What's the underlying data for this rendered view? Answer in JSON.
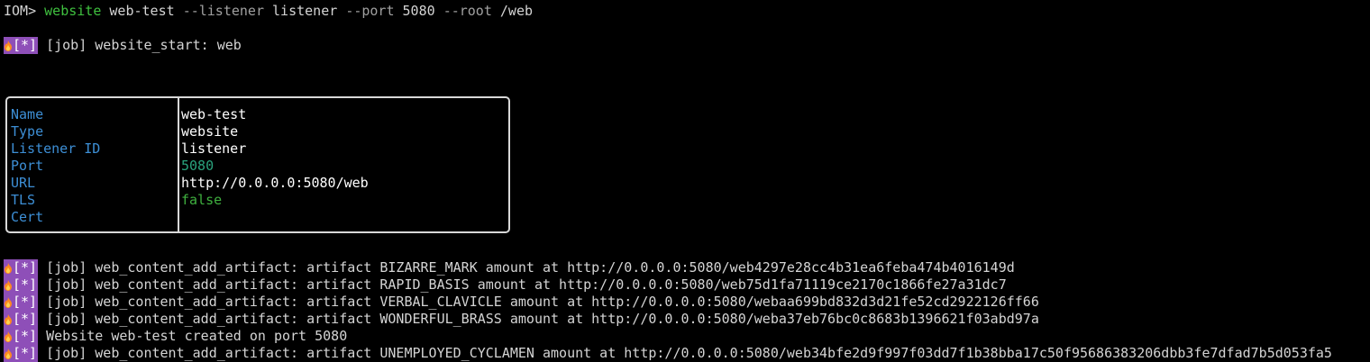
{
  "prompt": {
    "prefix": "IOM>",
    "command": "website",
    "name": "web-test",
    "flag_listener": "--listener",
    "listener_value": "listener",
    "flag_port": "--port",
    "port_value": "5080",
    "flag_root": "--root",
    "root_value": "/web"
  },
  "badge_text": "[*]",
  "job_start": "[job] website_start: web",
  "table": {
    "rows": [
      {
        "key": "Name",
        "value": "web-test"
      },
      {
        "key": "Type",
        "value": "website"
      },
      {
        "key": "Listener ID",
        "value": "listener"
      },
      {
        "key": "Port",
        "value": "5080"
      },
      {
        "key": "URL",
        "value": "http://0.0.0.0:5080/web"
      },
      {
        "key": "TLS",
        "value": "false"
      },
      {
        "key": "Cert",
        "value": ""
      }
    ]
  },
  "log_lines": [
    "[job] web_content_add_artifact: artifact BIZARRE_MARK amount at http://0.0.0.0:5080/web4297e28cc4b31ea6feba474b4016149d",
    "[job] web_content_add_artifact: artifact RAPID_BASIS amount at http://0.0.0.0:5080/web75d1fa71119ce2170c1866fe27a31dc7",
    "[job] web_content_add_artifact: artifact VERBAL_CLAVICLE amount at http://0.0.0.0:5080/webaa699bd832d3d21fe52cd2922126ff66",
    "[job] web_content_add_artifact: artifact WONDERFUL_BRASS amount at http://0.0.0.0:5080/weba37eb76bc0c8683b1396621f03abd97a",
    "Website web-test created on port 5080",
    "[job] web_content_add_artifact: artifact UNEMPLOYED_CYCLAMEN amount at http://0.0.0.0:5080/web34bfe2d9f997f03dd7f1b38bba17c50f95686383206dbb3fe7dfad7b5d053fa5"
  ],
  "colors": {
    "background": "#000000",
    "command": "#3fc03f",
    "badge": "#8e4fb8",
    "key": "#3d8fd6",
    "number": "#2aa37d",
    "boolean": "#3fb03f"
  },
  "icons": {
    "status": "flame-icon"
  }
}
